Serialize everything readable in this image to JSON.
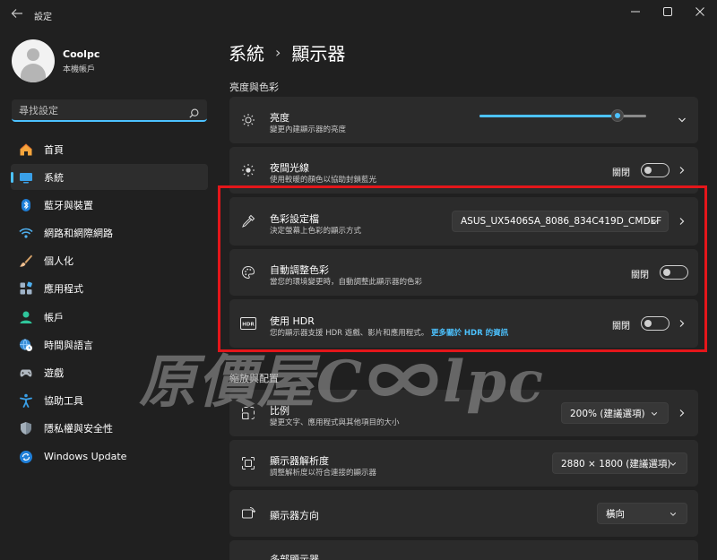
{
  "window": {
    "title": "設定"
  },
  "profile": {
    "name": "Coolpc",
    "account_type": "本機帳戶"
  },
  "search": {
    "placeholder": "尋找設定"
  },
  "sidebar": {
    "items": [
      {
        "label": "首頁",
        "icon": "home-icon",
        "active": false
      },
      {
        "label": "系統",
        "icon": "system-display-icon",
        "active": true
      },
      {
        "label": "藍牙與裝置",
        "icon": "bluetooth-icon",
        "active": false
      },
      {
        "label": "網路和網際網路",
        "icon": "wifi-icon",
        "active": false
      },
      {
        "label": "個人化",
        "icon": "brush-icon",
        "active": false
      },
      {
        "label": "應用程式",
        "icon": "apps-icon",
        "active": false
      },
      {
        "label": "帳戶",
        "icon": "person-icon",
        "active": false
      },
      {
        "label": "時間與語言",
        "icon": "globe-clock-icon",
        "active": false
      },
      {
        "label": "遊戲",
        "icon": "gamepad-icon",
        "active": false
      },
      {
        "label": "協助工具",
        "icon": "accessibility-icon",
        "active": false
      },
      {
        "label": "隱私權與安全性",
        "icon": "shield-icon",
        "active": false
      },
      {
        "label": "Windows Update",
        "icon": "update-icon",
        "active": false
      }
    ]
  },
  "breadcrumb": {
    "parent": "系統",
    "separator": "›",
    "current": "顯示器"
  },
  "sections": {
    "brightness_color": "亮度與色彩",
    "scale_layout": "縮放與配置"
  },
  "settings": {
    "brightness": {
      "title": "亮度",
      "subtitle": "變更內建顯示器的亮度",
      "value_percent": 83
    },
    "night_light": {
      "title": "夜間光線",
      "subtitle": "使用較暖的顏色以協助封鎖藍光",
      "toggle_label": "關閉",
      "on": false
    },
    "color_profile": {
      "title": "色彩設定檔",
      "subtitle": "決定螢幕上色彩的顯示方式",
      "value": "ASUS_UX5406SA_8086_834C419D_CMDEF"
    },
    "auto_color": {
      "title": "自動調整色彩",
      "subtitle": "當您的環境變更時，自動調整此顯示器的色彩",
      "toggle_label": "關閉",
      "on": false
    },
    "hdr": {
      "title": "使用 HDR",
      "subtitle": "您的顯示器支援 HDR 遊戲、影片和應用程式。",
      "link": "更多關於 HDR 的資訊",
      "toggle_label": "關閉",
      "on": false
    },
    "scale": {
      "title": "比例",
      "subtitle": "變更文字、應用程式與其他項目的大小",
      "value": "200% (建議選項)"
    },
    "resolution": {
      "title": "顯示器解析度",
      "subtitle": "調整解析度以符合連接的顯示器",
      "value": "2880 × 1800 (建議選項)"
    },
    "orientation": {
      "title": "顯示器方向",
      "value": "橫向"
    },
    "multi_display": {
      "title": "多部顯示器"
    }
  },
  "watermark": {
    "text_cjk": "原價屋",
    "text_c": "C",
    "text_lpc": "lpc"
  },
  "colors": {
    "accent": "#4cc2ff",
    "highlight_frame": "#e4161a",
    "background": "#202020",
    "card": "#2b2b2b"
  }
}
